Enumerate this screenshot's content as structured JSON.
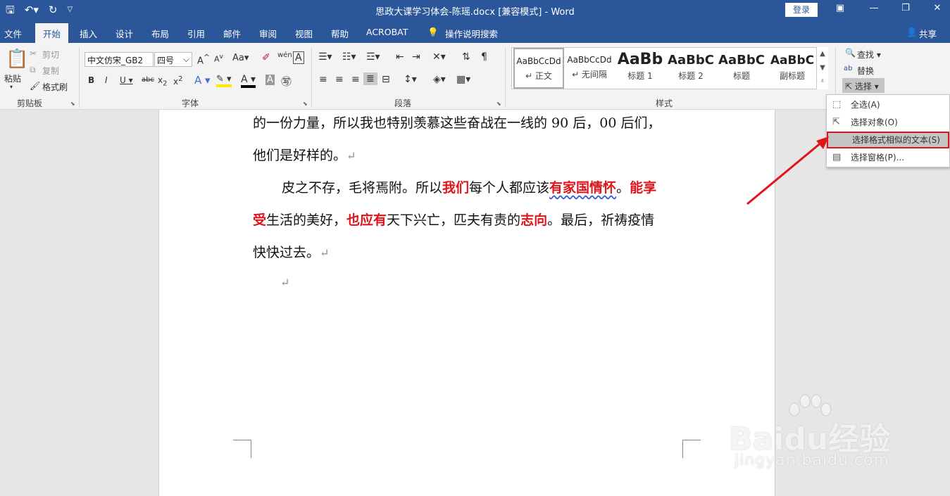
{
  "titlebar": {
    "title": "思政大课学习体会-陈瑶.docx [兼容模式] - Word",
    "login_label": "登录",
    "qat_icons": [
      "save-icon",
      "undo-icon",
      "redo-icon",
      "customize-icon"
    ],
    "window_buttons": [
      "ribbon-display-icon",
      "minimize-icon",
      "restore-icon",
      "close-icon"
    ]
  },
  "menubar": {
    "tabs": [
      "文件",
      "开始",
      "插入",
      "设计",
      "布局",
      "引用",
      "邮件",
      "审阅",
      "视图",
      "帮助",
      "ACROBAT"
    ],
    "active_tab": "开始",
    "tell_me": "操作说明搜索",
    "share": "共享"
  },
  "ribbon": {
    "clipboard": {
      "label": "剪贴板",
      "paste": "粘贴",
      "cut": "剪切",
      "copy": "复制",
      "format_painter": "格式刷"
    },
    "font": {
      "label": "字体",
      "font_name": "中文仿宋_GB2",
      "font_size": "四号",
      "case": "Aa"
    },
    "paragraph": {
      "label": "段落"
    },
    "styles": {
      "label": "样式",
      "items": [
        {
          "preview": "AaBbCcDd",
          "name": "↵ 正文"
        },
        {
          "preview": "AaBbCcDd",
          "name": "↵ 无间隔"
        },
        {
          "preview": "AaBb",
          "name": "标题 1"
        },
        {
          "preview": "AaBbC",
          "name": "标题 2"
        },
        {
          "preview": "AaBbC",
          "name": "标题"
        },
        {
          "preview": "AaBbC",
          "name": "副标题"
        }
      ]
    },
    "editing": {
      "find": "查找",
      "replace": "替换",
      "select": "选择"
    }
  },
  "document": {
    "line1": "的一份力量，所以我也特别羡慕这些奋战在一线的 90 后，00 后们，",
    "line2": "他们是好样的。",
    "line3_a": "皮之不存，毛将焉附。所以",
    "line3_b": "我们",
    "line3_c": "每个人都应该",
    "line3_d": "有家国情怀",
    "line3_e": "。",
    "line3_f": "能享",
    "line4_a": "受",
    "line4_b": "生活的美好，",
    "line4_c": "也应有",
    "line4_d": "天下兴亡，匹夫有责的",
    "line4_e": "志向",
    "line4_f": "。最后，祈祷疫情",
    "line5": "快快过去。",
    "para_mark": "↵"
  },
  "select_menu": {
    "items": [
      "全选(A)",
      "选择对象(O)",
      "选择格式相似的文本(S)",
      "选择窗格(P)..."
    ],
    "highlighted": "选择格式相似的文本(S)"
  },
  "watermark": {
    "main": "Baidu经验",
    "sub": "jingyan.baidu.com"
  },
  "colors": {
    "brand": "#2b579a",
    "highlight_red": "#e1141b"
  }
}
